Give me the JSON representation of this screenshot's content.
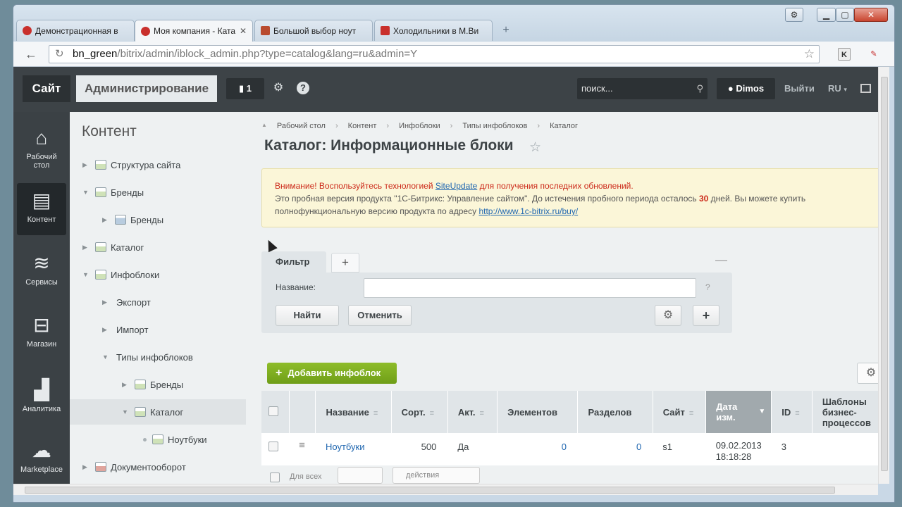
{
  "browser": {
    "tabs": [
      {
        "title": "Демонстрационная в",
        "active": false,
        "color": "#c9302c"
      },
      {
        "title": "Моя компания - Ката",
        "active": true,
        "color": "#c9302c"
      },
      {
        "title": "Большой выбор ноут",
        "active": false,
        "color": "#b94b2f"
      },
      {
        "title": "Холодильники в М.Ви",
        "active": false,
        "color": "#c9302c"
      }
    ],
    "url_host": "bn_green",
    "url_path": "/bitrix/admin/iblock_admin.php?type=catalog&lang=ru&admin=Y"
  },
  "panel": {
    "site_label": "Сайт",
    "admin_label": "Администрирование",
    "notif_count": "1",
    "search_placeholder": "поиск...",
    "user_name": "Dimos",
    "logout_label": "Выйти",
    "lang_label": "RU"
  },
  "leftmenu": [
    {
      "label_1": "Рабочий",
      "label_2": "стол",
      "icon": "home-icon"
    },
    {
      "label_1": "Контент",
      "label_2": "",
      "icon": "document-icon"
    },
    {
      "label_1": "Сервисы",
      "label_2": "",
      "icon": "layers-icon"
    },
    {
      "label_1": "Магазин",
      "label_2": "",
      "icon": "basket-icon"
    },
    {
      "label_1": "Аналитика",
      "label_2": "",
      "icon": "chart-icon"
    },
    {
      "label_1": "Marketplace",
      "label_2": "",
      "icon": "cloud-icon"
    }
  ],
  "tree": {
    "title": "Контент",
    "items": [
      {
        "label": "Структура сайта"
      },
      {
        "label": "Бренды"
      },
      {
        "label": "Бренды"
      },
      {
        "label": "Каталог"
      },
      {
        "label": "Инфоблоки"
      },
      {
        "label": "Экспорт"
      },
      {
        "label": "Импорт"
      },
      {
        "label": "Типы инфоблоков"
      },
      {
        "label": "Бренды"
      },
      {
        "label": "Каталог"
      },
      {
        "label": "Ноутбуки"
      },
      {
        "label": "Документооборот"
      }
    ]
  },
  "breadcrumbs": [
    "Рабочий стол",
    "Контент",
    "Инфоблоки",
    "Типы инфоблоков",
    "Каталог"
  ],
  "page_title": "Каталог: Информационные блоки",
  "notice": {
    "warning_prefix": "Внимание! Воспользуйтесь технологией",
    "link1": "SiteUpdate",
    "warning_suffix": "для получения последних обновлений.",
    "line2_a": "Это пробная версия продукта \"1С-Битрикс: Управление сайтом\". До истечения пробного периода осталось",
    "days": "30",
    "line2_b": "дней. Вы можете купить",
    "line3": "полнофункциональную версию продукта по адресу",
    "link2": "http://www.1c-bitrix.ru/buy/"
  },
  "filter": {
    "tab_label": "Фильтр",
    "name_label": "Название:",
    "name_value": "",
    "help": "?",
    "find_label": "Найти",
    "cancel_label": "Отменить"
  },
  "add_button_label": "Добавить инфоблок",
  "table": {
    "columns": [
      "Название",
      "Сорт.",
      "Акт.",
      "Элементов",
      "Разделов",
      "Сайт",
      "Дата изм.",
      "ID",
      "Шаблоны бизнес-процессов"
    ],
    "date_col_line1": "Дата",
    "date_col_line2": "изм.",
    "bp_line1": "Шаблоны",
    "bp_line2": "бизнес-",
    "bp_line3": "процессов",
    "rows": [
      {
        "name": "Ноутбуки",
        "sort": "500",
        "active": "Да",
        "elements": "0",
        "sections": "0",
        "site": "s1",
        "date": "09.02.2013",
        "time": "18:18:28",
        "id": "3"
      }
    ],
    "footer_all": "Для всех",
    "footer_action": "действия"
  }
}
